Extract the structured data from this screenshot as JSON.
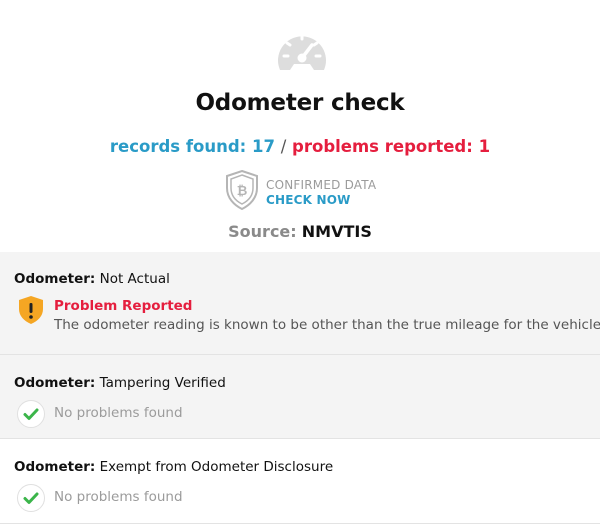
{
  "header": {
    "title": "Odometer check",
    "records_label": "records found:",
    "records_count": "17",
    "separator": "/",
    "problems_label": "problems reported:",
    "problems_count": "1",
    "badge_line1": "CONFIRMED DATA",
    "badge_line2": "CHECK NOW",
    "source_label": "Source:",
    "source_value": "NMVTIS"
  },
  "rows": [
    {
      "label": "Odometer:",
      "value": "Not Actual",
      "status_heading": "Problem Reported",
      "status_text": "The odometer reading is known to be other than the true mileage for the vehicle.",
      "status": "problem",
      "icon": "warning-shield-icon"
    },
    {
      "label": "Odometer:",
      "value": "Tampering Verified",
      "status_text": "No problems found",
      "status": "ok",
      "icon": "check-circle-icon"
    },
    {
      "label": "Odometer:",
      "value": "Exempt from Odometer Disclosure",
      "status_text": "No problems found",
      "status": "ok",
      "icon": "check-circle-icon"
    }
  ],
  "colors": {
    "accent_blue": "#2a9bc7",
    "problem_red": "#e51e3e",
    "warning_orange": "#f5a623",
    "ok_green": "#3bb54a",
    "icon_grey": "#dcdcdc"
  }
}
